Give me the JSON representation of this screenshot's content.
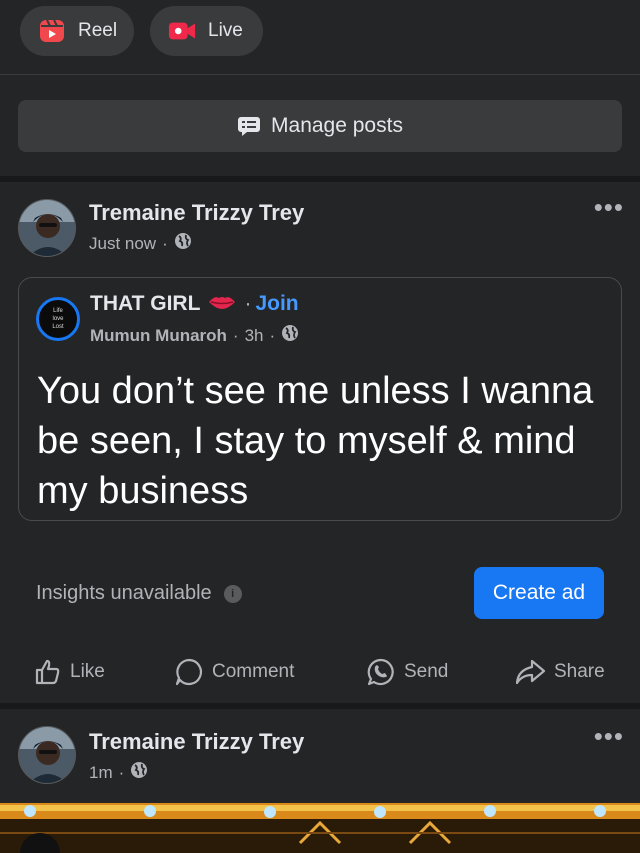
{
  "chips": {
    "reel_label": "Reel",
    "live_label": "Live"
  },
  "manage": {
    "label": "Manage posts"
  },
  "post1": {
    "author": "Tremaine Trizzy Trey",
    "time": "Just now",
    "shared": {
      "group_name": "THAT GIRL",
      "join_label": "Join",
      "group_avatar_text": [
        "Life",
        "love",
        "Lost"
      ],
      "poster": "Mumun Munaroh",
      "time": "3h",
      "text": "You don’t see me unless I wanna be seen, I stay to myself & mind my business"
    },
    "insights": "Insights unavailable",
    "create_ad": "Create ad",
    "actions": {
      "like": "Like",
      "comment": "Comment",
      "send": "Send",
      "share": "Share"
    }
  },
  "post2": {
    "author": "Tremaine Trizzy Trey",
    "time": "1m"
  },
  "colors": {
    "background": "#242526",
    "divider": "#18191a",
    "chip": "#3a3b3c",
    "accent": "#1877f2",
    "join_link": "#4599ff",
    "secondary_text": "#b0b3b8",
    "reel_icon": "#f0484c",
    "live_icon": "#f02849"
  },
  "icons": {
    "reel": "reel-icon",
    "live": "live-video-icon",
    "manage": "message-list-icon",
    "privacy": "globe-icon",
    "like": "thumbs-up-icon",
    "comment": "comment-bubble-icon",
    "send": "messenger-icon",
    "share": "share-arrow-icon",
    "more": "more-dots-icon",
    "info": "info-icon"
  }
}
